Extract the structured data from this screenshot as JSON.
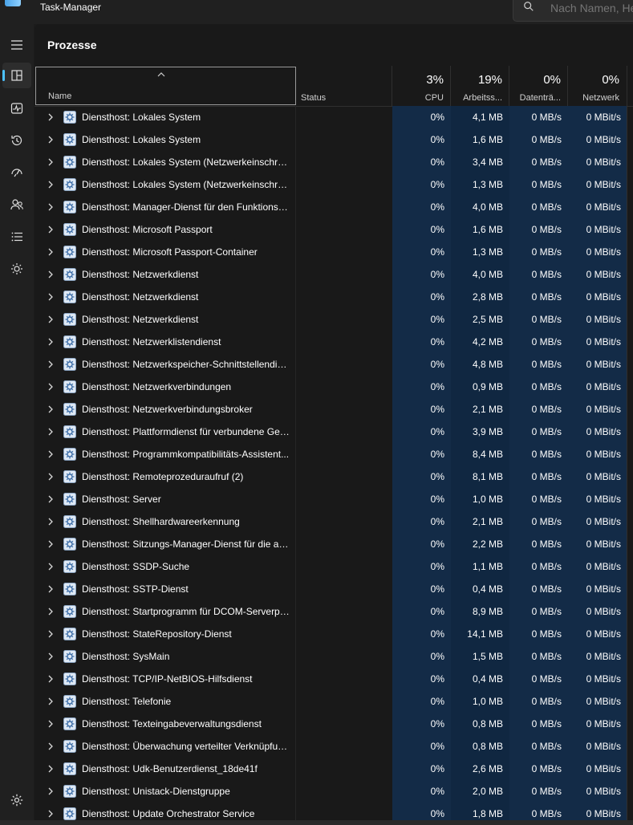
{
  "window": {
    "title": "Task-Manager"
  },
  "search": {
    "placeholder": "Nach Namen, He"
  },
  "sidebar": {
    "items": [
      {
        "icon": "hamburger-icon"
      },
      {
        "icon": "processes-icon",
        "active": true
      },
      {
        "icon": "performance-icon"
      },
      {
        "icon": "app-history-icon"
      },
      {
        "icon": "startup-apps-icon"
      },
      {
        "icon": "users-icon"
      },
      {
        "icon": "details-icon"
      },
      {
        "icon": "services-icon"
      }
    ],
    "settings_icon": "gear-icon"
  },
  "page": {
    "title": "Prozesse"
  },
  "columns": {
    "name": {
      "label": "Name"
    },
    "status": {
      "label": "Status"
    },
    "cpu": {
      "pct": "3%",
      "label": "CPU"
    },
    "memory": {
      "pct": "19%",
      "label": "Arbeitss..."
    },
    "disk": {
      "pct": "0%",
      "label": "Datenträ..."
    },
    "network": {
      "pct": "0%",
      "label": "Netzwerk"
    }
  },
  "colors": {
    "accent": "#4cc2ff",
    "heat": "#132b47",
    "background": "#191919"
  },
  "rows": [
    {
      "name": "Diensthost: Lokales System",
      "status": "",
      "cpu": "0%",
      "memory": "4,1 MB",
      "disk": "0 MB/s",
      "network": "0 MBit/s"
    },
    {
      "name": "Diensthost: Lokales System",
      "status": "",
      "cpu": "0%",
      "memory": "1,6 MB",
      "disk": "0 MB/s",
      "network": "0 MBit/s"
    },
    {
      "name": "Diensthost: Lokales System (Netzwerkeinschrän...",
      "status": "",
      "cpu": "0%",
      "memory": "3,4 MB",
      "disk": "0 MB/s",
      "network": "0 MBit/s"
    },
    {
      "name": "Diensthost: Lokales System (Netzwerkeinschrän...",
      "status": "",
      "cpu": "0%",
      "memory": "1,3 MB",
      "disk": "0 MB/s",
      "network": "0 MBit/s"
    },
    {
      "name": "Diensthost: Manager-Dienst für den Funktionsz...",
      "status": "",
      "cpu": "0%",
      "memory": "4,0 MB",
      "disk": "0 MB/s",
      "network": "0 MBit/s"
    },
    {
      "name": "Diensthost: Microsoft Passport",
      "status": "",
      "cpu": "0%",
      "memory": "1,6 MB",
      "disk": "0 MB/s",
      "network": "0 MBit/s"
    },
    {
      "name": "Diensthost: Microsoft Passport-Container",
      "status": "",
      "cpu": "0%",
      "memory": "1,3 MB",
      "disk": "0 MB/s",
      "network": "0 MBit/s"
    },
    {
      "name": "Diensthost: Netzwerkdienst",
      "status": "",
      "cpu": "0%",
      "memory": "4,0 MB",
      "disk": "0 MB/s",
      "network": "0 MBit/s"
    },
    {
      "name": "Diensthost: Netzwerkdienst",
      "status": "",
      "cpu": "0%",
      "memory": "2,8 MB",
      "disk": "0 MB/s",
      "network": "0 MBit/s"
    },
    {
      "name": "Diensthost: Netzwerkdienst",
      "status": "",
      "cpu": "0%",
      "memory": "2,5 MB",
      "disk": "0 MB/s",
      "network": "0 MBit/s"
    },
    {
      "name": "Diensthost: Netzwerklistendienst",
      "status": "",
      "cpu": "0%",
      "memory": "4,2 MB",
      "disk": "0 MB/s",
      "network": "0 MBit/s"
    },
    {
      "name": "Diensthost: Netzwerkspeicher-Schnittstellendie...",
      "status": "",
      "cpu": "0%",
      "memory": "4,8 MB",
      "disk": "0 MB/s",
      "network": "0 MBit/s"
    },
    {
      "name": "Diensthost: Netzwerkverbindungen",
      "status": "",
      "cpu": "0%",
      "memory": "0,9 MB",
      "disk": "0 MB/s",
      "network": "0 MBit/s"
    },
    {
      "name": "Diensthost: Netzwerkverbindungsbroker",
      "status": "",
      "cpu": "0%",
      "memory": "2,1 MB",
      "disk": "0 MB/s",
      "network": "0 MBit/s"
    },
    {
      "name": "Diensthost: Plattformdienst für verbundene Ger...",
      "status": "",
      "cpu": "0%",
      "memory": "3,9 MB",
      "disk": "0 MB/s",
      "network": "0 MBit/s"
    },
    {
      "name": "Diensthost: Programmkompatibilitäts-Assistent...",
      "status": "",
      "cpu": "0%",
      "memory": "8,4 MB",
      "disk": "0 MB/s",
      "network": "0 MBit/s"
    },
    {
      "name": "Diensthost: Remoteprozeduraufruf (2)",
      "status": "",
      "cpu": "0%",
      "memory": "8,1 MB",
      "disk": "0 MB/s",
      "network": "0 MBit/s"
    },
    {
      "name": "Diensthost: Server",
      "status": "",
      "cpu": "0%",
      "memory": "1,0 MB",
      "disk": "0 MB/s",
      "network": "0 MBit/s"
    },
    {
      "name": "Diensthost: Shellhardwareerkennung",
      "status": "",
      "cpu": "0%",
      "memory": "2,1 MB",
      "disk": "0 MB/s",
      "network": "0 MBit/s"
    },
    {
      "name": "Diensthost: Sitzungs-Manager-Dienst für die ak...",
      "status": "",
      "cpu": "0%",
      "memory": "2,2 MB",
      "disk": "0 MB/s",
      "network": "0 MBit/s"
    },
    {
      "name": "Diensthost: SSDP-Suche",
      "status": "",
      "cpu": "0%",
      "memory": "1,1 MB",
      "disk": "0 MB/s",
      "network": "0 MBit/s"
    },
    {
      "name": "Diensthost: SSTP-Dienst",
      "status": "",
      "cpu": "0%",
      "memory": "0,4 MB",
      "disk": "0 MB/s",
      "network": "0 MBit/s"
    },
    {
      "name": "Diensthost: Startprogramm für DCOM-Serverpr...",
      "status": "",
      "cpu": "0%",
      "memory": "8,9 MB",
      "disk": "0 MB/s",
      "network": "0 MBit/s"
    },
    {
      "name": "Diensthost: StateRepository-Dienst",
      "status": "",
      "cpu": "0%",
      "memory": "14,1 MB",
      "disk": "0 MB/s",
      "network": "0 MBit/s"
    },
    {
      "name": "Diensthost: SysMain",
      "status": "",
      "cpu": "0%",
      "memory": "1,5 MB",
      "disk": "0 MB/s",
      "network": "0 MBit/s"
    },
    {
      "name": "Diensthost: TCP/IP-NetBIOS-Hilfsdienst",
      "status": "",
      "cpu": "0%",
      "memory": "0,4 MB",
      "disk": "0 MB/s",
      "network": "0 MBit/s"
    },
    {
      "name": "Diensthost: Telefonie",
      "status": "",
      "cpu": "0%",
      "memory": "1,0 MB",
      "disk": "0 MB/s",
      "network": "0 MBit/s"
    },
    {
      "name": "Diensthost: Texteingabeverwaltungsdienst",
      "status": "",
      "cpu": "0%",
      "memory": "0,8 MB",
      "disk": "0 MB/s",
      "network": "0 MBit/s"
    },
    {
      "name": "Diensthost: Überwachung verteilter Verknüpfun...",
      "status": "",
      "cpu": "0%",
      "memory": "0,8 MB",
      "disk": "0 MB/s",
      "network": "0 MBit/s"
    },
    {
      "name": "Diensthost: Udk-Benutzerdienst_18de41f",
      "status": "",
      "cpu": "0%",
      "memory": "2,6 MB",
      "disk": "0 MB/s",
      "network": "0 MBit/s"
    },
    {
      "name": "Diensthost: Unistack-Dienstgruppe",
      "status": "",
      "cpu": "0%",
      "memory": "2,0 MB",
      "disk": "0 MB/s",
      "network": "0 MBit/s"
    },
    {
      "name": "Diensthost: Update Orchestrator Service",
      "status": "",
      "cpu": "0%",
      "memory": "1,8 MB",
      "disk": "0 MB/s",
      "network": "0 MBit/s"
    }
  ]
}
